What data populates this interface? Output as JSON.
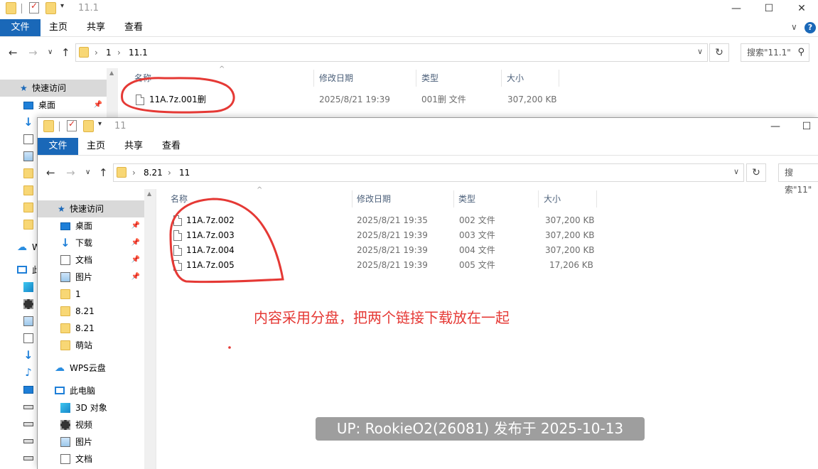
{
  "back": {
    "title": "11.1",
    "tabs": {
      "file": "文件",
      "home": "主页",
      "share": "共享",
      "view": "查看"
    },
    "path": [
      "1",
      "11.1"
    ],
    "search_placeholder": "搜索\"11.1\"",
    "sidebar": {
      "quick_access": "快速访问",
      "desktop": "桌面",
      "wps_cut": "W",
      "pc_cut": "此"
    },
    "columns": {
      "name": "名称",
      "date": "修改日期",
      "type": "类型",
      "size": "大小"
    },
    "files": [
      {
        "name": "11A.7z.001删",
        "date": "2025/8/21 19:39",
        "type": "001删 文件",
        "size": "307,200 KB"
      }
    ]
  },
  "front": {
    "title": "11",
    "tabs": {
      "file": "文件",
      "home": "主页",
      "share": "共享",
      "view": "查看"
    },
    "path": [
      "8.21",
      "11"
    ],
    "search_placeholder": "搜索\"11\"",
    "sidebar": {
      "quick_access": "快速访问",
      "desktop": "桌面",
      "downloads": "下载",
      "documents": "文档",
      "pictures": "图片",
      "folder_1": "1",
      "folder_821a": "8.21",
      "folder_821b": "8.21",
      "folder_mz": "萌站",
      "wps": "WPS云盘",
      "this_pc": "此电脑",
      "objects3d": "3D 对象",
      "videos": "视频",
      "pc_pictures": "图片",
      "pc_documents": "文档"
    },
    "columns": {
      "name": "名称",
      "date": "修改日期",
      "type": "类型",
      "size": "大小"
    },
    "files": [
      {
        "name": "11A.7z.002",
        "date": "2025/8/21 19:35",
        "type": "002 文件",
        "size": "307,200 KB"
      },
      {
        "name": "11A.7z.003",
        "date": "2025/8/21 19:39",
        "type": "003 文件",
        "size": "307,200 KB"
      },
      {
        "name": "11A.7z.004",
        "date": "2025/8/21 19:39",
        "type": "004 文件",
        "size": "307,200 KB"
      },
      {
        "name": "11A.7z.005",
        "date": "2025/8/21 19:39",
        "type": "005 文件",
        "size": "17,206 KB"
      }
    ]
  },
  "annotation_text": "内容采用分盘，把两个链接下载放在一起",
  "watermark": "UP: RookieO2(26081) 发布于 2025-10-13",
  "colors": {
    "accent": "#1a68b8",
    "annotation": "#e53935"
  }
}
